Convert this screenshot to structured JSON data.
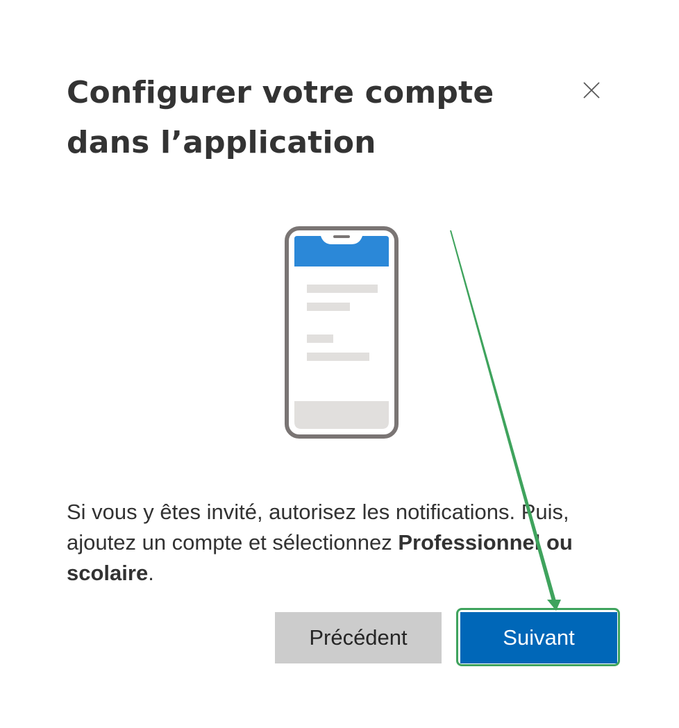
{
  "dialog": {
    "title_line1": "Configurer votre compte",
    "title_line2": "dans l’application",
    "close_icon": "close-icon",
    "body_text_1": "Si vous y êtes invité, autorisez les notifications. Puis, ajoutez un compte et sélectionnez ",
    "body_text_bold": "Professionnel ou scolaire",
    "body_text_2": ".",
    "prev_button": "Précédent",
    "next_button": "Suivant"
  },
  "colors": {
    "primary": "#0067b8",
    "secondary_button": "#cccccc",
    "phone_header": "#2b88d8",
    "phone_frame": "#7a7574",
    "annotation": "#3fa35d"
  }
}
